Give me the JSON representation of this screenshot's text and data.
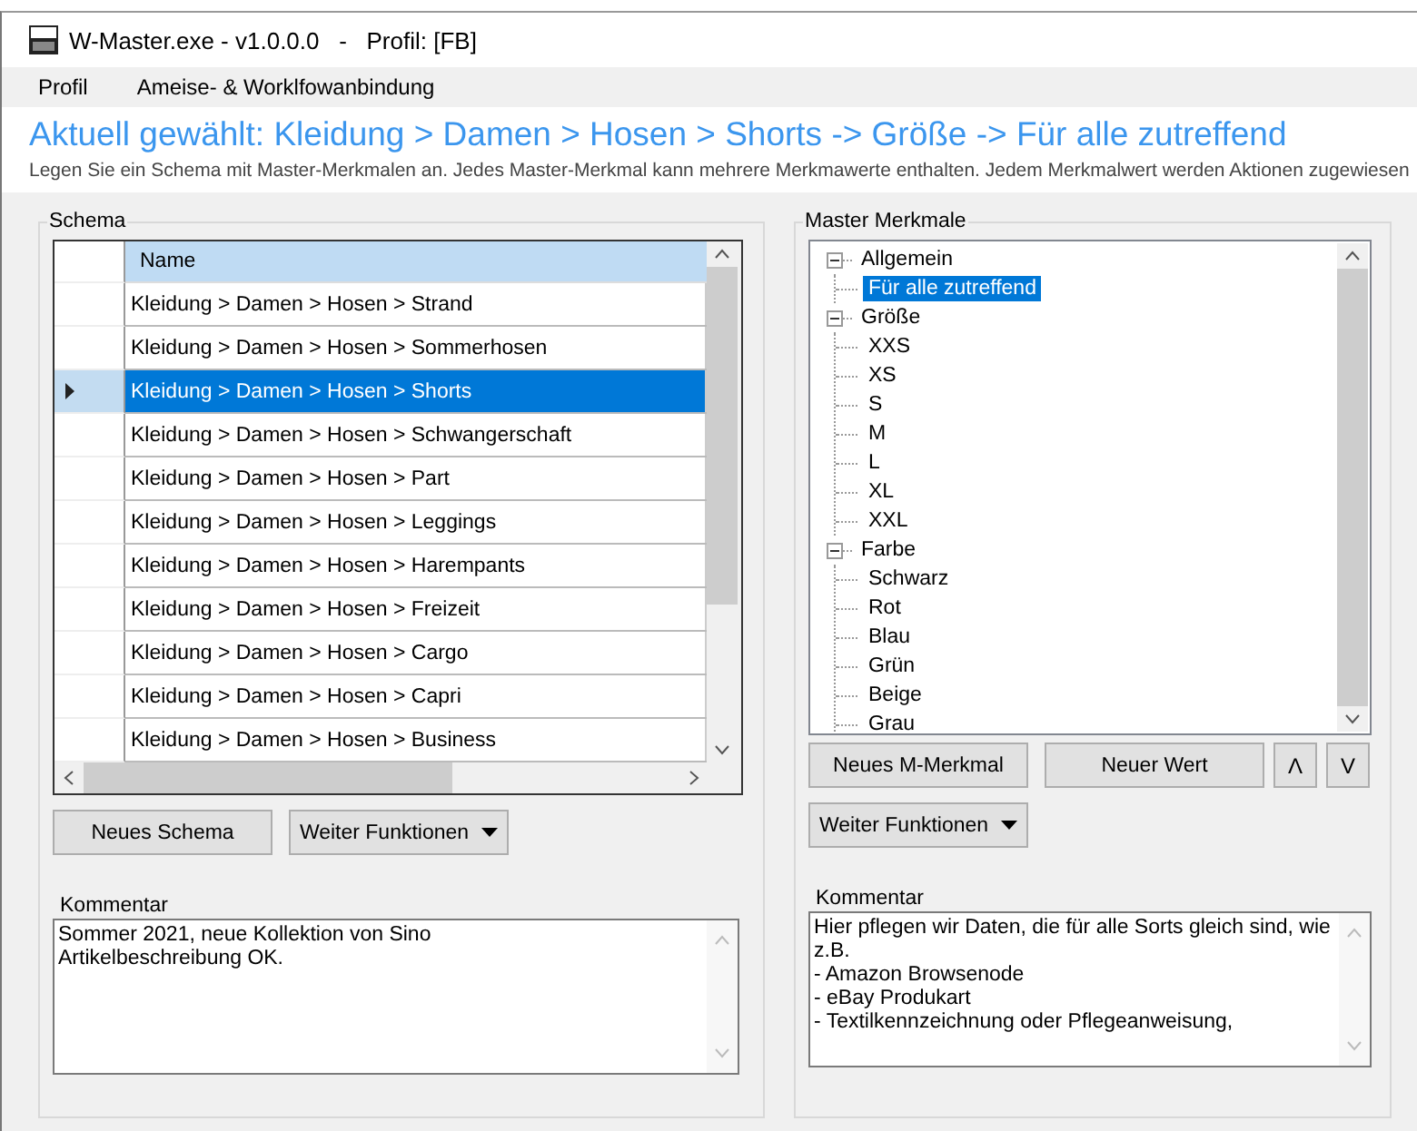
{
  "window": {
    "title": "W-Master.exe - v1.0.0.0   -   Profil: [FB]"
  },
  "menu": [
    "Profil",
    "Ameise- & Worklfowanbindung"
  ],
  "heading": "Aktuell gewählt: Kleidung > Damen > Hosen > Shorts -> Größe -> Für alle zutreffend",
  "description": "Legen Sie ein Schema mit Master-Merkmalen an. Jedes Master-Merkmal kann mehrere Merkmawerte enthalten. Jedem Merkmalwert werden Aktionen zugewiesen",
  "schema": {
    "title": "Schema",
    "columns": [
      "Name"
    ],
    "rows": [
      {
        "name": "Kleidung > Damen > Hosen > Strand",
        "selected": false
      },
      {
        "name": "Kleidung > Damen > Hosen > Sommerhosen",
        "selected": false
      },
      {
        "name": "Kleidung > Damen > Hosen > Shorts",
        "selected": true
      },
      {
        "name": "Kleidung > Damen > Hosen > Schwangerschaft",
        "selected": false
      },
      {
        "name": "Kleidung > Damen > Hosen > Part",
        "selected": false
      },
      {
        "name": "Kleidung > Damen > Hosen > Leggings",
        "selected": false
      },
      {
        "name": "Kleidung > Damen > Hosen > Harempants",
        "selected": false
      },
      {
        "name": "Kleidung > Damen > Hosen > Freizeit",
        "selected": false
      },
      {
        "name": "Kleidung > Damen > Hosen > Cargo",
        "selected": false
      },
      {
        "name": "Kleidung > Damen > Hosen > Capri",
        "selected": false
      },
      {
        "name": "Kleidung > Damen > Hosen > Business",
        "selected": false
      }
    ],
    "buttons": [
      {
        "label": "Neues Schema",
        "kind": "plain"
      },
      {
        "label": "Weiter Funktionen",
        "kind": "dropdown"
      }
    ],
    "comment_label": "Kommentar",
    "comment": "Sommer 2021, neue Kollektion von Sino\nArtikelbeschreibung OK."
  },
  "master": {
    "title": "Master Merkmale",
    "tree": [
      {
        "label": "Allgemein",
        "expanded": true,
        "selected": false,
        "children": [
          {
            "label": "Für alle zutreffend",
            "selected": true
          }
        ]
      },
      {
        "label": "Größe",
        "expanded": true,
        "selected": false,
        "children": [
          {
            "label": "XXS",
            "selected": false
          },
          {
            "label": "XS",
            "selected": false
          },
          {
            "label": "S",
            "selected": false
          },
          {
            "label": "M",
            "selected": false
          },
          {
            "label": "L",
            "selected": false
          },
          {
            "label": "XL",
            "selected": false
          },
          {
            "label": "XXL",
            "selected": false
          }
        ]
      },
      {
        "label": "Farbe",
        "expanded": true,
        "selected": false,
        "children": [
          {
            "label": "Schwarz",
            "selected": false
          },
          {
            "label": "Rot",
            "selected": false
          },
          {
            "label": "Blau",
            "selected": false
          },
          {
            "label": "Grün",
            "selected": false
          },
          {
            "label": "Beige",
            "selected": false
          },
          {
            "label": "Grau",
            "selected": false
          }
        ]
      }
    ],
    "buttons": [
      {
        "label": "Neues M-Merkmal",
        "kind": "plain"
      },
      {
        "label": "Neuer Wert",
        "kind": "plain"
      },
      {
        "label": "Λ",
        "kind": "arrow"
      },
      {
        "label": "V",
        "kind": "arrow"
      }
    ],
    "more_button": {
      "label": "Weiter Funktionen",
      "kind": "dropdown"
    },
    "comment_label": "Kommentar",
    "comment": "Hier pflegen wir Daten, die für alle Sorts gleich sind, wie\nz.B.\n- Amazon Browsenode\n- eBay Produkart\n- Textilkennzeichnung oder Pflegeanweisung,"
  }
}
